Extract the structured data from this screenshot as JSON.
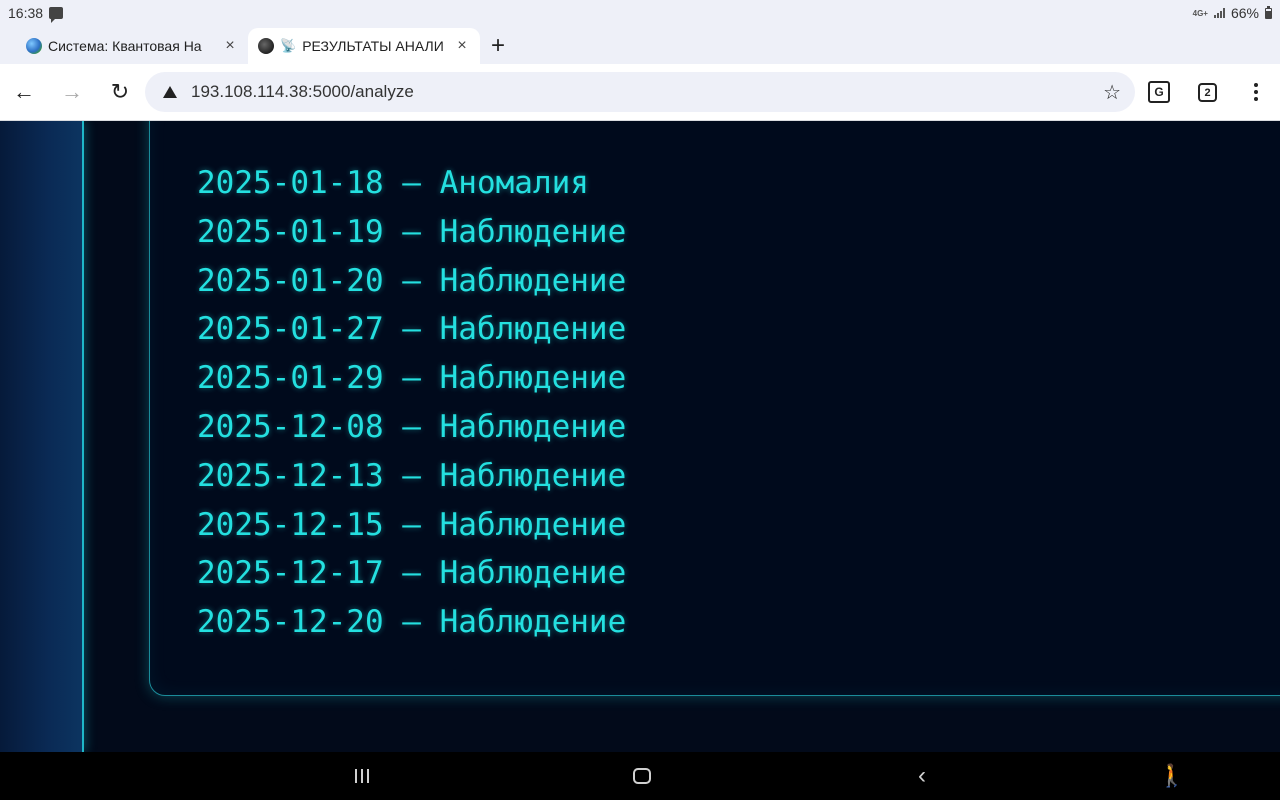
{
  "status_bar": {
    "time": "16:38",
    "network": "4G+",
    "battery": "66%"
  },
  "tabs": [
    {
      "title": "Система: Квантовая На",
      "active": false,
      "close": "×"
    },
    {
      "title": "РЕЗУЛЬТАТЫ АНАЛИ",
      "active": true,
      "close": "×"
    }
  ],
  "new_tab_label": "+",
  "toolbar": {
    "back": "←",
    "forward": "→",
    "reload": "↻",
    "url": "193.108.114.38:5000/analyze",
    "bookmark": "☆",
    "translate": "G",
    "tab_count": "2"
  },
  "results": [
    "2025-01-18 — Аномалия",
    "2025-01-19 — Наблюдение",
    "2025-01-20 — Наблюдение",
    "2025-01-27 — Наблюдение",
    "2025-01-29 — Наблюдение",
    "2025-12-08 — Наблюдение",
    "2025-12-13 — Наблюдение",
    "2025-12-15 — Наблюдение",
    "2025-12-17 — Наблюдение",
    "2025-12-20 — Наблюдение"
  ],
  "nav": {
    "back": "‹",
    "accessibility": "🚶"
  },
  "colors": {
    "accent": "#24e0e0",
    "panel_border": "#1b8c9a",
    "page_bg": "#020a1a"
  }
}
